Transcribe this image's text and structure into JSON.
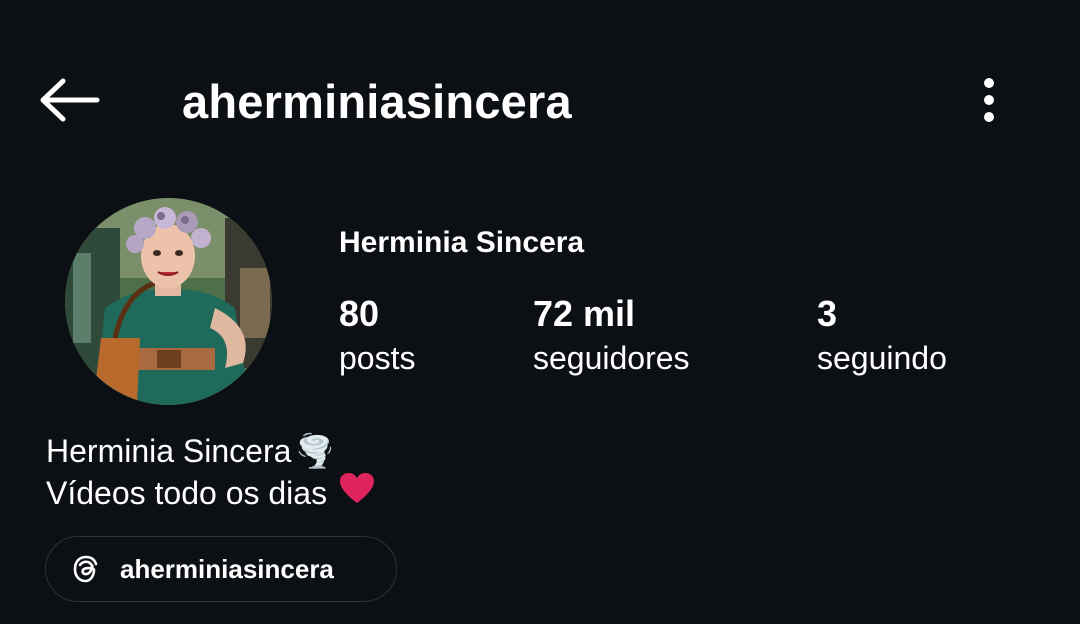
{
  "header": {
    "username": "aherminiasincera"
  },
  "profile": {
    "display_name": "Herminia Sincera",
    "stats": [
      {
        "value": "80",
        "label": "posts"
      },
      {
        "value": "72 mil",
        "label": "seguidores"
      },
      {
        "value": "3",
        "label": "seguindo"
      }
    ],
    "bio": {
      "line1": "Herminia Sincera",
      "line1_emoji": "🌪️",
      "line2": "Vídeos todo os dias",
      "line2_emoji": "❤️"
    },
    "threads_link": {
      "label": "aherminiasincera",
      "icon": "threads-icon"
    }
  },
  "icons": {
    "back": "arrow-left-icon",
    "more": "more-vertical-icon"
  },
  "colors": {
    "background": "#0c0f14",
    "text": "#ffffff",
    "chip_border": "#2e333a",
    "heart": "#e0245e"
  }
}
